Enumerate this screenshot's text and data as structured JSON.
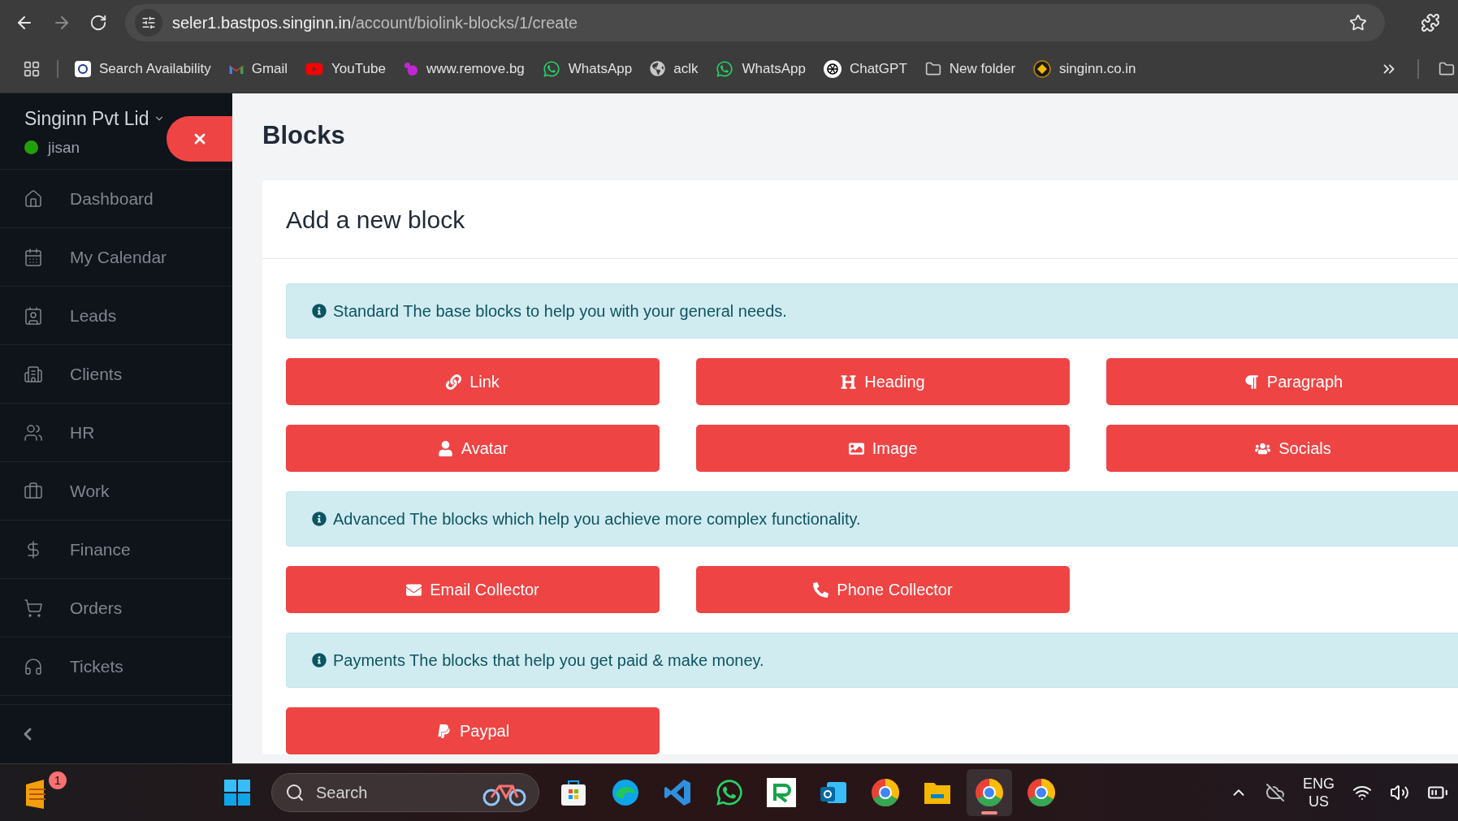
{
  "browser": {
    "url_host": "seler1.bastpos.singinn.in",
    "url_path": "/account/biolink-blocks/1/create",
    "bookmarks": [
      {
        "label": "Search Availability"
      },
      {
        "label": "Gmail"
      },
      {
        "label": "YouTube"
      },
      {
        "label": "www.remove.bg"
      },
      {
        "label": "WhatsApp"
      },
      {
        "label": "aclk"
      },
      {
        "label": "WhatsApp"
      },
      {
        "label": "ChatGPT"
      },
      {
        "label": "New folder"
      },
      {
        "label": "singinn.co.in"
      }
    ]
  },
  "sidebar": {
    "company": "Singinn Pvt Lid",
    "user": "jisan",
    "online": true,
    "items": [
      {
        "label": "Dashboard"
      },
      {
        "label": "My Calendar"
      },
      {
        "label": "Leads"
      },
      {
        "label": "Clients"
      },
      {
        "label": "HR"
      },
      {
        "label": "Work"
      },
      {
        "label": "Finance"
      },
      {
        "label": "Orders"
      },
      {
        "label": "Tickets"
      }
    ]
  },
  "page": {
    "title": "Blocks",
    "card_title": "Add a new block",
    "sections": [
      {
        "info": "Standard The base blocks to help you with your general needs.",
        "blocks": [
          {
            "label": "Link",
            "kind": "link"
          },
          {
            "label": "Heading",
            "kind": "heading"
          },
          {
            "label": "Paragraph",
            "kind": "paragraph"
          },
          {
            "label": "Avatar",
            "kind": "avatar"
          },
          {
            "label": "Image",
            "kind": "image"
          },
          {
            "label": "Socials",
            "kind": "socials"
          }
        ]
      },
      {
        "info": "Advanced The blocks which help you achieve more complex functionality.",
        "blocks": [
          {
            "label": "Email Collector",
            "kind": "email"
          },
          {
            "label": "Phone Collector",
            "kind": "phone"
          }
        ]
      },
      {
        "info": "Payments The blocks that help you get paid & make money.",
        "blocks": [
          {
            "label": "Paypal",
            "kind": "paypal"
          }
        ]
      }
    ]
  },
  "taskbar": {
    "widget_badge": "1",
    "search_placeholder": "Search",
    "apps": [
      {
        "selected": false
      },
      {
        "selected": false
      },
      {
        "selected": false
      },
      {
        "selected": false
      },
      {
        "selected": false
      },
      {
        "selected": false
      },
      {
        "selected": false
      },
      {
        "selected": false
      },
      {
        "selected": false
      },
      {
        "selected": true
      },
      {
        "selected": false
      }
    ],
    "language": "ENG",
    "region": "US"
  }
}
